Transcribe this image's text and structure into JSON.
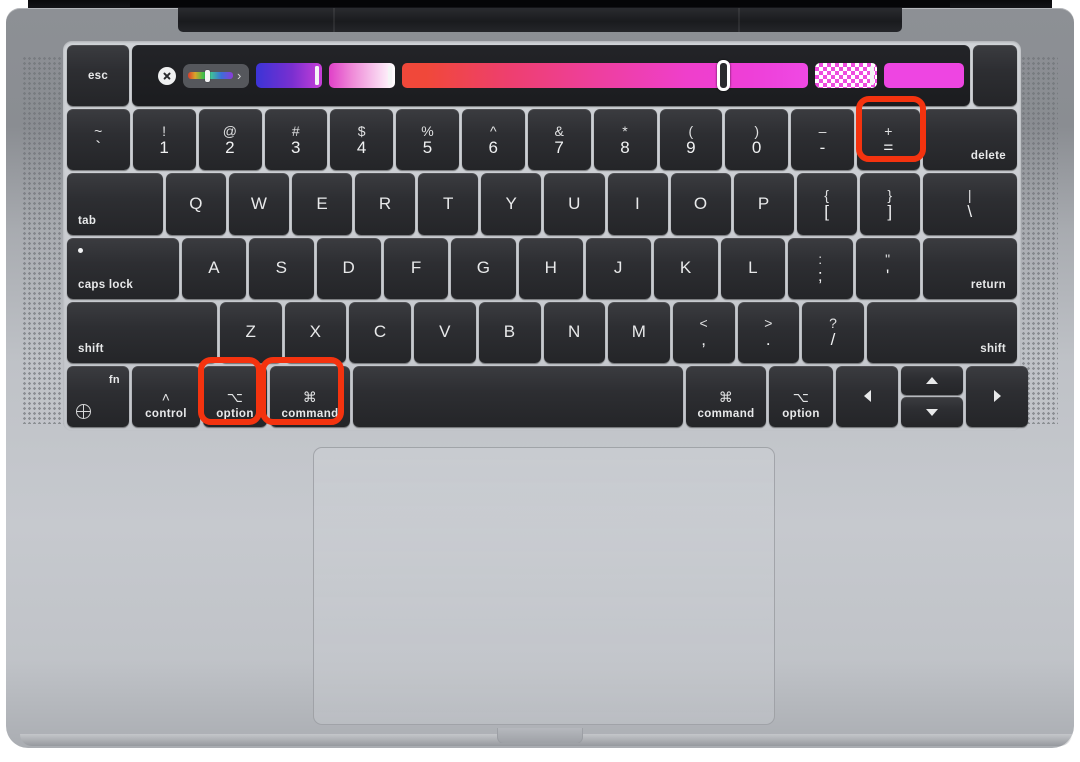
{
  "device": {
    "name": "MacBook Pro with Touch Bar",
    "body_color": "#b9bcc1",
    "key_color": "#2d2e32",
    "highlight_color": "#f4330f"
  },
  "highlights": [
    {
      "key": "equal-plus",
      "label": "+ ="
    },
    {
      "key": "option-left",
      "label": "option"
    },
    {
      "key": "command-left",
      "label": "command"
    }
  ],
  "touchbar": {
    "close_icon": "close-circle-icon",
    "color_picker": {
      "rainbow_label": "color-spectrum-strip",
      "chevron": "›"
    },
    "swatches": [
      {
        "name": "gradient-blue-magenta",
        "type": "gradient",
        "colors": [
          "#3b34d6",
          "#c83fd8"
        ]
      },
      {
        "name": "gradient-magenta-white",
        "type": "gradient",
        "colors": [
          "#e040c8",
          "#ffffff"
        ]
      },
      {
        "name": "hue-slider",
        "type": "slider",
        "colors": [
          "#f0483a",
          "#ef49e4"
        ],
        "handle_position_percent": 78
      },
      {
        "name": "checker-magenta",
        "type": "checkerboard",
        "colors": [
          "#ef4ae0",
          "#ffffff"
        ]
      },
      {
        "name": "solid-magenta",
        "type": "solid",
        "colors": [
          "#ee45e2"
        ]
      }
    ]
  },
  "keyboard": {
    "rows": [
      {
        "name": "function-row",
        "keys": [
          {
            "name": "esc",
            "label": "esc"
          }
        ]
      },
      {
        "name": "number-row",
        "keys": [
          {
            "name": "backtick",
            "top": "~",
            "bottom": "`"
          },
          {
            "name": "one",
            "top": "!",
            "bottom": "1"
          },
          {
            "name": "two",
            "top": "@",
            "bottom": "2"
          },
          {
            "name": "three",
            "top": "#",
            "bottom": "3"
          },
          {
            "name": "four",
            "top": "$",
            "bottom": "4"
          },
          {
            "name": "five",
            "top": "%",
            "bottom": "5"
          },
          {
            "name": "six",
            "top": "^",
            "bottom": "6"
          },
          {
            "name": "seven",
            "top": "&",
            "bottom": "7"
          },
          {
            "name": "eight",
            "top": "*",
            "bottom": "8"
          },
          {
            "name": "nine",
            "top": "(",
            "bottom": "9"
          },
          {
            "name": "zero",
            "top": ")",
            "bottom": "0"
          },
          {
            "name": "minus",
            "top": "–",
            "bottom": "-"
          },
          {
            "name": "equal",
            "top": "+",
            "bottom": "="
          },
          {
            "name": "delete",
            "label": "delete"
          }
        ]
      },
      {
        "name": "top-letter-row",
        "keys": [
          {
            "name": "tab",
            "label": "tab"
          },
          {
            "name": "q",
            "label": "Q"
          },
          {
            "name": "w",
            "label": "W"
          },
          {
            "name": "e",
            "label": "E"
          },
          {
            "name": "r",
            "label": "R"
          },
          {
            "name": "t",
            "label": "T"
          },
          {
            "name": "y",
            "label": "Y"
          },
          {
            "name": "u",
            "label": "U"
          },
          {
            "name": "i",
            "label": "I"
          },
          {
            "name": "o",
            "label": "O"
          },
          {
            "name": "p",
            "label": "P"
          },
          {
            "name": "bracket-left",
            "top": "{",
            "bottom": "["
          },
          {
            "name": "bracket-right",
            "top": "}",
            "bottom": "]"
          },
          {
            "name": "backslash",
            "top": "|",
            "bottom": "\\"
          }
        ]
      },
      {
        "name": "home-row",
        "keys": [
          {
            "name": "caps-lock",
            "label": "caps lock"
          },
          {
            "name": "a",
            "label": "A"
          },
          {
            "name": "s",
            "label": "S"
          },
          {
            "name": "d",
            "label": "D"
          },
          {
            "name": "f",
            "label": "F"
          },
          {
            "name": "g",
            "label": "G"
          },
          {
            "name": "h",
            "label": "H"
          },
          {
            "name": "j",
            "label": "J"
          },
          {
            "name": "k",
            "label": "K"
          },
          {
            "name": "l",
            "label": "L"
          },
          {
            "name": "semicolon",
            "top": ":",
            "bottom": ";"
          },
          {
            "name": "quote",
            "top": "\"",
            "bottom": "'"
          },
          {
            "name": "return",
            "label": "return"
          }
        ]
      },
      {
        "name": "bottom-letter-row",
        "keys": [
          {
            "name": "shift-left",
            "label": "shift"
          },
          {
            "name": "z",
            "label": "Z"
          },
          {
            "name": "x",
            "label": "X"
          },
          {
            "name": "c",
            "label": "C"
          },
          {
            "name": "v",
            "label": "V"
          },
          {
            "name": "b",
            "label": "B"
          },
          {
            "name": "n",
            "label": "N"
          },
          {
            "name": "m",
            "label": "M"
          },
          {
            "name": "comma",
            "top": "<",
            "bottom": ","
          },
          {
            "name": "period",
            "top": ">",
            "bottom": "."
          },
          {
            "name": "slash",
            "top": "?",
            "bottom": "/"
          },
          {
            "name": "shift-right",
            "label": "shift"
          }
        ]
      },
      {
        "name": "modifier-row",
        "keys": [
          {
            "name": "fn",
            "label": "fn",
            "icon": "globe-icon"
          },
          {
            "name": "control",
            "symbol": "˄",
            "label": "control"
          },
          {
            "name": "option-left",
            "symbol": "⌥",
            "label": "option"
          },
          {
            "name": "command-left",
            "symbol": "⌘",
            "label": "command"
          },
          {
            "name": "space",
            "label": ""
          },
          {
            "name": "command-right",
            "symbol": "⌘",
            "label": "command"
          },
          {
            "name": "option-right",
            "symbol": "⌥",
            "label": "option"
          },
          {
            "name": "arrow-left",
            "icon": "arrow-left-icon"
          },
          {
            "name": "arrow-up",
            "icon": "arrow-up-icon"
          },
          {
            "name": "arrow-down",
            "icon": "arrow-down-icon"
          },
          {
            "name": "arrow-right",
            "icon": "arrow-right-icon"
          }
        ]
      }
    ]
  },
  "trackpad": {
    "name": "trackpad"
  }
}
